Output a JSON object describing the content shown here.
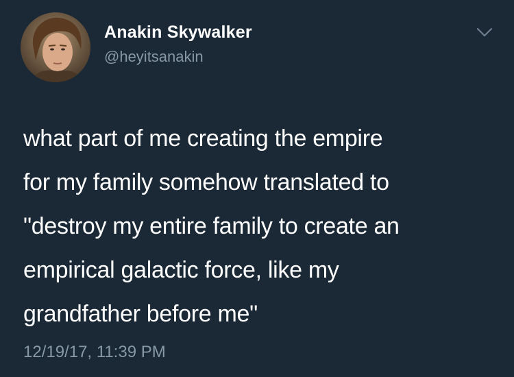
{
  "tweet": {
    "author": {
      "display_name": "Anakin Skywalker",
      "handle": "@heyitsanakin"
    },
    "text": "what part of me creating the empire\nfor my family somehow translated to\n\"destroy my entire family to create an\nempirical galactic force, like my\ngrandfather before me\"",
    "timestamp": "12/19/17, 11:39 PM",
    "menu_icon": "chevron-down-icon"
  },
  "colors": {
    "background": "#1b2836",
    "primary_text": "#ffffff",
    "secondary_text": "#8899a6"
  }
}
